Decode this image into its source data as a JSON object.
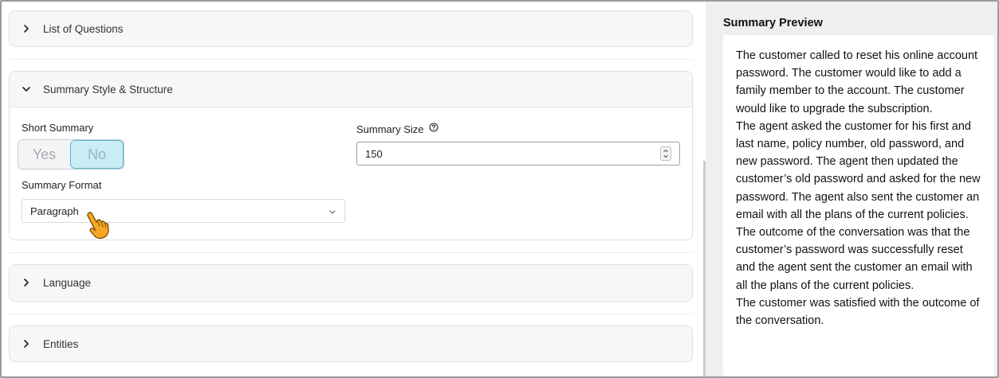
{
  "sections": {
    "questions": {
      "label": "List of Questions"
    },
    "style": {
      "label": "Summary Style & Structure",
      "short_summary_label": "Short Summary",
      "toggle": {
        "yes": "Yes",
        "no": "No",
        "selected": "No"
      },
      "format_label": "Summary Format",
      "format_value": "Paragraph",
      "size_label": "Summary Size",
      "size_value": "150"
    },
    "language": {
      "label": "Language"
    },
    "entities": {
      "label": "Entities"
    }
  },
  "preview": {
    "title": "Summary Preview",
    "paragraphs": [
      "The customer called to reset his online account password. The customer would like to add a family member to the account. The customer would like to upgrade the subscription.",
      "The agent asked the customer for his first and last name, policy number, old password, and new password. The agent then updated the customer’s old password and asked for the new password. The agent also sent the customer an email with all the plans of the current policies.",
      "The outcome of the conversation was that the customer’s password was successfully reset and the agent sent the customer an email with all the plans of the current policies.",
      "The customer was satisfied with the outcome of the conversation."
    ]
  },
  "colors": {
    "toggle_active_bg": "#c9ecf5",
    "toggle_active_border": "#5bb5cf",
    "pointer": "#f5a623"
  },
  "icons": {
    "chevron_right": "chevron-right-icon",
    "chevron_down": "chevron-down-icon",
    "help": "help-circle-icon",
    "pointer": "hand-pointer-icon"
  }
}
